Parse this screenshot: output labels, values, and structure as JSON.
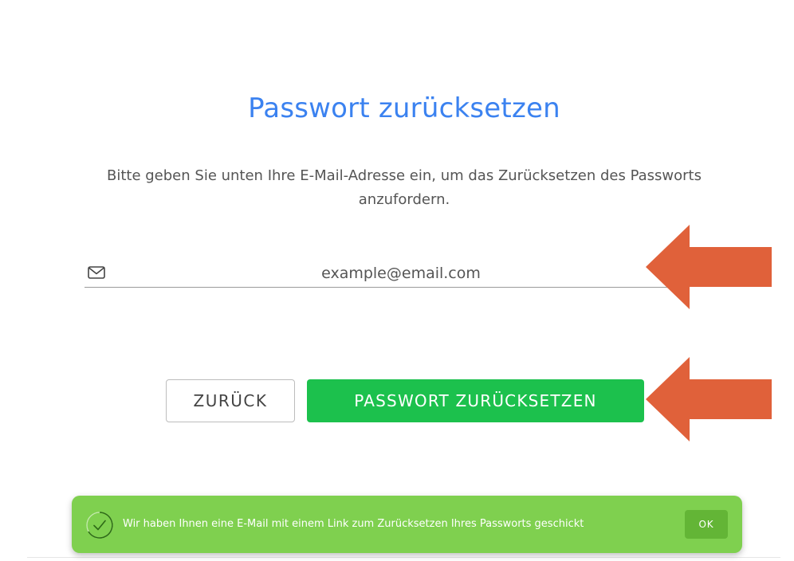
{
  "page": {
    "title": "Passwort zurücksetzen",
    "subtitle": "Bitte geben Sie unten Ihre E-Mail-Adresse ein, um das Zurücksetzen des Passworts anzufordern."
  },
  "email": {
    "placeholder": "example@email.com",
    "value": "",
    "icon": "envelope-icon"
  },
  "buttons": {
    "back_label": "ZURÜCK",
    "reset_label": "PASSWORT ZURÜCKSETZEN"
  },
  "toast": {
    "message": "Wir haben Ihnen eine E-Mail mit einem Link zum Zurücksetzen Ihres Passworts geschickt",
    "ok_label": "OK",
    "icon": "check-circle-icon"
  },
  "annotations": {
    "arrow_color": "#e0613a",
    "arrow_icon": "left-arrow-icon"
  },
  "colors": {
    "title": "#3b82f0",
    "primary_button": "#1cc14d",
    "toast_background": "#7fd04f",
    "toast_button": "#63b536"
  }
}
